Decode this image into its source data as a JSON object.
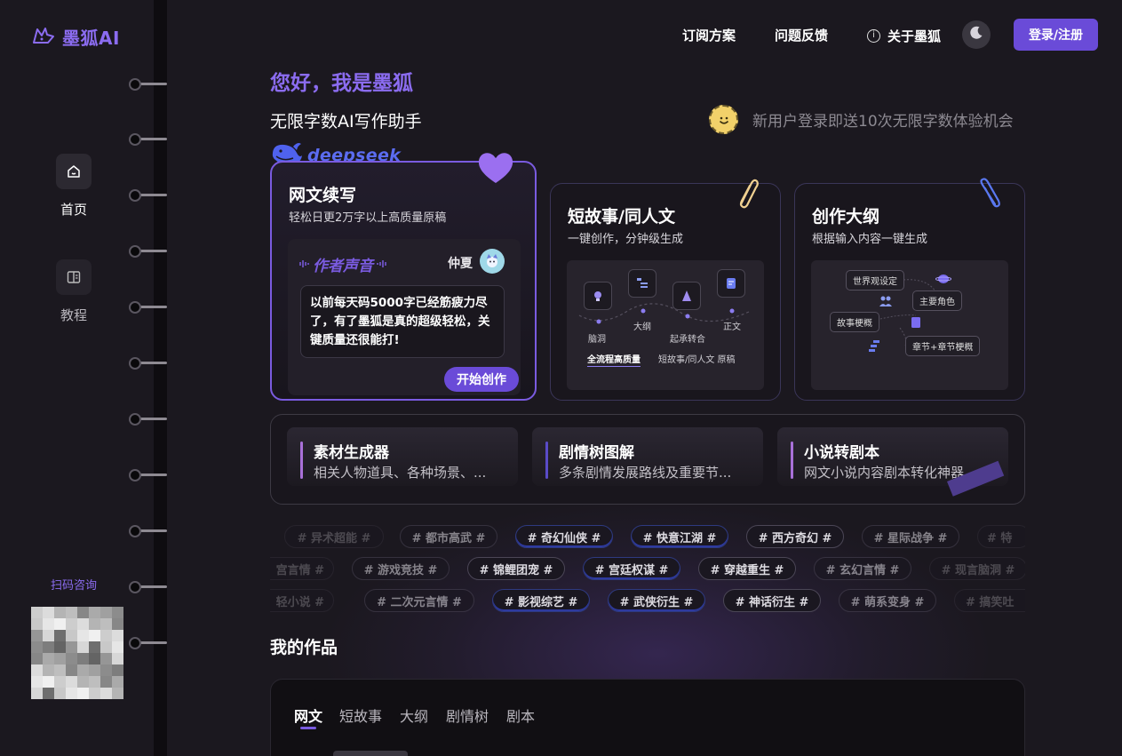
{
  "app": {
    "logo_text": "墨狐AI"
  },
  "sidebar": {
    "items": [
      {
        "label": "首页",
        "icon": "home-icon",
        "active": true
      },
      {
        "label": "教程",
        "icon": "book-icon",
        "active": false
      }
    ],
    "qr_label": "扫码咨询"
  },
  "header": {
    "nav": [
      "订阅方案",
      "问题反馈",
      "关于墨狐"
    ],
    "theme_icon": "moon-icon",
    "login_label": "登录/注册"
  },
  "hero": {
    "greeting": "您好，我是墨狐",
    "subtitle": "无限字数AI写作助手",
    "promo": "新用户登录即送10次无限字数体验机会",
    "partner": "deepseek"
  },
  "cards": {
    "main": {
      "title": "网文续写",
      "desc": "轻松日更2万字以上高质量原稿",
      "voice_title": "作者声音",
      "voice_user": "仲夏",
      "quote": "以前每天码5000字已经筋疲力尽了，有了墨狐是真的超级轻松，关键质量还很能打!",
      "cta": "开始创作"
    },
    "story": {
      "title": "短故事/同人文",
      "desc": "一键创作，分钟级生成",
      "steps": [
        "脑洞",
        "大纲",
        "起承转合",
        "正文"
      ],
      "footer_left": "全流程高质量",
      "footer_right": "短故事/同人文 原稿"
    },
    "outline": {
      "title": "创作大纲",
      "desc": "根据输入内容一键生成",
      "nodes": [
        "世界观设定",
        "主要角色",
        "故事梗概",
        "章节+章节梗概"
      ]
    }
  },
  "tools": [
    {
      "title": "素材生成器",
      "desc": "相关人物道具、各种场景、...",
      "color": "#a870d8"
    },
    {
      "title": "剧情树图解",
      "desc": "多条剧情发展路线及重要节...",
      "color": "#5a4bc8"
    },
    {
      "title": "小说转剧本",
      "desc": "网文小说内容剧本转化神器",
      "color": "#a870d8"
    }
  ],
  "tags": {
    "row1": [
      "# 异术超能 #",
      "# 都市高武 #",
      "# 奇幻仙侠 #",
      "# 快意江湖 #",
      "# 西方奇幻 #",
      "# 星际战争 #",
      "# 特"
    ],
    "row2": [
      "宫言情 #",
      "# 游戏竞技 #",
      "# 锦鲤团宠 #",
      "# 宫廷权谋 #",
      "# 穿越重生 #",
      "# 玄幻言情 #",
      "# 现言脑洞 #"
    ],
    "row3": [
      "轻小说 #",
      "# 二次元言情 #",
      "# 影视综艺 #",
      "# 武侠衍生 #",
      "# 神话衍生 #",
      "# 萌系变身 #",
      "# 搞笑吐"
    ]
  },
  "works": {
    "title": "我的作品",
    "tabs": [
      "网文",
      "短故事",
      "大纲",
      "剧情树",
      "剧本"
    ],
    "active_tab": "网文"
  }
}
